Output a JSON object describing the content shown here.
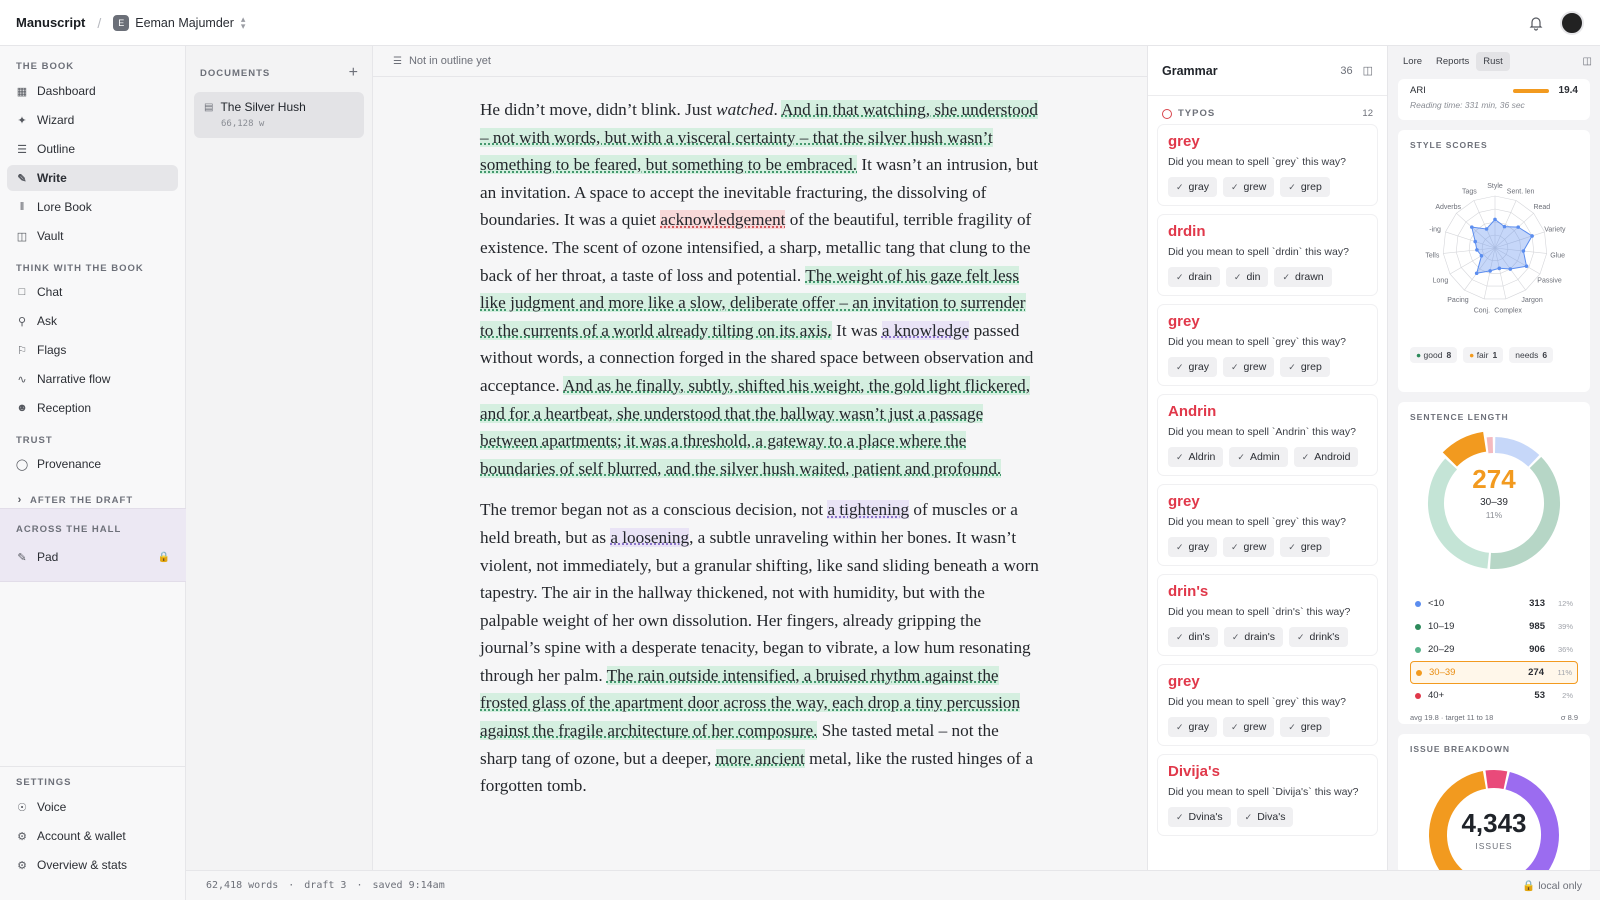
{
  "topbar": {
    "app_title": "Manuscript",
    "separator": "/",
    "user_initial": "E",
    "user_name": "Eeman Majumder"
  },
  "sidebar": {
    "sections": [
      {
        "title": "THE BOOK"
      },
      {
        "title": "THINK WITH THE BOOK"
      },
      {
        "title": "TRUST"
      }
    ],
    "book_items": [
      {
        "label": "Dashboard",
        "icon": "grid-icon"
      },
      {
        "label": "Wizard",
        "icon": "wand-icon"
      },
      {
        "label": "Outline",
        "icon": "list-icon"
      },
      {
        "label": "Write",
        "icon": "pen-icon"
      },
      {
        "label": "Lore Book",
        "icon": "books-icon"
      },
      {
        "label": "Vault",
        "icon": "archive-icon"
      }
    ],
    "think_items": [
      {
        "label": "Chat",
        "icon": "chat-icon"
      },
      {
        "label": "Ask",
        "icon": "search-icon"
      },
      {
        "label": "Flags",
        "icon": "flag-icon"
      },
      {
        "label": "Narrative flow",
        "icon": "pulse-icon"
      },
      {
        "label": "Reception",
        "icon": "users-icon"
      }
    ],
    "trust_items": [
      {
        "label": "Provenance",
        "icon": "shield-icon"
      }
    ],
    "after_draft": "AFTER THE DRAFT",
    "hall_title": "ACROSS THE HALL",
    "hall_item": "Pad",
    "settings_title": "SETTINGS",
    "settings_items": [
      {
        "label": "Voice",
        "icon": "mic-icon"
      },
      {
        "label": "Account & wallet",
        "icon": "gear-icon"
      },
      {
        "label": "Overview & stats",
        "icon": "gear-icon"
      }
    ]
  },
  "documents": {
    "title": "DOCUMENTS",
    "items": [
      {
        "title": "The Silver Hush",
        "words": "66,128 w"
      }
    ]
  },
  "editor": {
    "outline_status": "Not in outline yet",
    "p1": [
      {
        "t": "He didn’t move, didn’t blink. Just ",
        "s": ""
      },
      {
        "t": "watched",
        "s": "i"
      },
      {
        "t": ". ",
        "s": ""
      },
      {
        "t": "And in that watching, she un­derstood – not with words, but with a visceral certainty – that the silver hush wasn’t something to be feared, but something to be embraced.",
        "s": "g"
      },
      {
        "t": " It wasn’t an intrusion, but an invitation. A space to accept the inevitable fracturing, the dissolving of boundaries. It was a quiet ",
        "s": ""
      },
      {
        "t": "acknowledgement",
        "s": "r"
      },
      {
        "t": " of the beautiful, terrible fragility of existence. The scent of ozone intensi­fied, a sharp, metallic tang that clung to the back of her throat, a taste of loss and potential. ",
        "s": ""
      },
      {
        "t": "The weight of his gaze felt less like judgment and more like a slow, deliberate offer – an invitation to surrender to the currents of a world already tilting on its axis.",
        "s": "g"
      },
      {
        "t": " It was ",
        "s": ""
      },
      {
        "t": "a knowledge",
        "s": "p"
      },
      {
        "t": " passed without words, a connection forged in the shared space between observation and acceptance. ",
        "s": ""
      },
      {
        "t": "And as he finally, subtly, shifted his weight, the gold light flickered, and for a heartbeat, she understood that the hallway wasn’t just a passage between apartments; it was a threshold, a gateway to a place where the boundaries of self blurred, and the silver hush waited, patient and profound.",
        "s": "g"
      }
    ],
    "p2": [
      {
        "t": "The tremor began not as a conscious decision, not ",
        "s": ""
      },
      {
        "t": "a tightening",
        "s": "p"
      },
      {
        "t": " of muscles or a held breath, but as ",
        "s": ""
      },
      {
        "t": "a loosening",
        "s": "p"
      },
      {
        "t": ", a subtle unraveling within her bones. It wasn’t violent, not immediately, but a granular shifting, like sand sliding beneath a worn tapestry. The air in the hallway thickened, not with hu­midity, but with the palpable weight of her own dissolution. Her fingers, already gripping the journal’s spine with a desperate tenacity, began to vi­brate, a low hum resonating through her palm. ",
        "s": ""
      },
      {
        "t": "The rain outside intensi­fied, a bruised rhythm against the frosted glass of the apartment door across the way, each drop a tiny percussion against the fragile architecture of her composure.",
        "s": "g"
      },
      {
        "t": " She tasted metal – not the sharp tang of ozone, but a deeper, ",
        "s": ""
      },
      {
        "t": "more ancient",
        "s": "g"
      },
      {
        "t": " metal, like the rusted hinges of a forgotten tomb.",
        "s": ""
      }
    ]
  },
  "footer": {
    "words": "62,418 words",
    "draft": "draft 3",
    "saved": "saved 9:14am",
    "local": "local only"
  },
  "grammar": {
    "title": "Grammar",
    "count": "36",
    "typos_label": "TYPOS",
    "typos_count": "12",
    "cards": [
      {
        "word": "grey",
        "question": "Did you mean to spell `grey` this way?",
        "suggestions": [
          "gray",
          "grew",
          "grep"
        ]
      },
      {
        "word": "drdin",
        "question": "Did you mean to spell `drdin` this way?",
        "suggestions": [
          "drain",
          "din",
          "drawn"
        ]
      },
      {
        "word": "grey",
        "question": "Did you mean to spell `grey` this way?",
        "suggestions": [
          "gray",
          "grew",
          "grep"
        ]
      },
      {
        "word": "Andrin",
        "question": "Did you mean to spell `Andrin` this way?",
        "suggestions": [
          "Aldrin",
          "Admin",
          "Android"
        ]
      },
      {
        "word": "grey",
        "question": "Did you mean to spell `grey` this way?",
        "suggestions": [
          "gray",
          "grew",
          "grep"
        ]
      },
      {
        "word": "drin's",
        "question": "Did you mean to spell `drin's` this way?",
        "suggestions": [
          "din's",
          "drain's",
          "drink's"
        ]
      },
      {
        "word": "grey",
        "question": "Did you mean to spell `grey` this way?",
        "suggestions": [
          "gray",
          "grew",
          "grep"
        ]
      },
      {
        "word": "Divija's",
        "question": "Did you mean to spell `Divija's` this way?",
        "suggestions": [
          "Dvina's",
          "Diva's"
        ]
      }
    ]
  },
  "right": {
    "tabs": [
      "Lore",
      "Reports",
      "Rust"
    ],
    "ari_label": "ARI",
    "ari_value": "19.4",
    "reading_time": "Reading time: 331 min, 36 sec",
    "style_title": "STYLE SCORES",
    "radar_axes": [
      "Style",
      "Sent. len",
      "Read",
      "Variety",
      "Glue",
      "Passive",
      "Jargon",
      "Complex",
      "Conj.",
      "Pacing",
      "Long",
      "Tells",
      "-ing",
      "Adverbs",
      "Tags"
    ],
    "radar_values": [
      0.55,
      0.45,
      0.6,
      0.75,
      0.55,
      0.7,
      0.5,
      0.4,
      0.45,
      0.6,
      0.3,
      0.35,
      0.4,
      0.6,
      0.4
    ],
    "score_chips": [
      {
        "label": "good",
        "count": "8",
        "color": "#2d8a5b"
      },
      {
        "label": "fair",
        "count": "1",
        "color": "#f29a1f"
      },
      {
        "label": "needs",
        "count": "6",
        "color": "#e0384a"
      }
    ],
    "sentence_title": "SENTENCE LENGTH",
    "donut_value": "274",
    "donut_range": "30–39",
    "donut_pct": "11%",
    "buckets": [
      {
        "label": "<10",
        "count": "313",
        "pct": "12%",
        "color": "#5b8def"
      },
      {
        "label": "10–19",
        "count": "985",
        "pct": "39%",
        "color": "#2d8a5b"
      },
      {
        "label": "20–29",
        "count": "906",
        "pct": "36%",
        "color": "#57b38a"
      },
      {
        "label": "30–39",
        "count": "274",
        "pct": "11%",
        "color": "#f29a1f"
      },
      {
        "label": "40+",
        "count": "53",
        "pct": "2%",
        "color": "#e0384a"
      }
    ],
    "avg_text": "avg 19.8 · target 11 to 18",
    "sigma_text": "σ 8.9",
    "issue_title": "ISSUE BREAKDOWN",
    "issues_total": "4,343",
    "issues_label": "ISSUES"
  }
}
